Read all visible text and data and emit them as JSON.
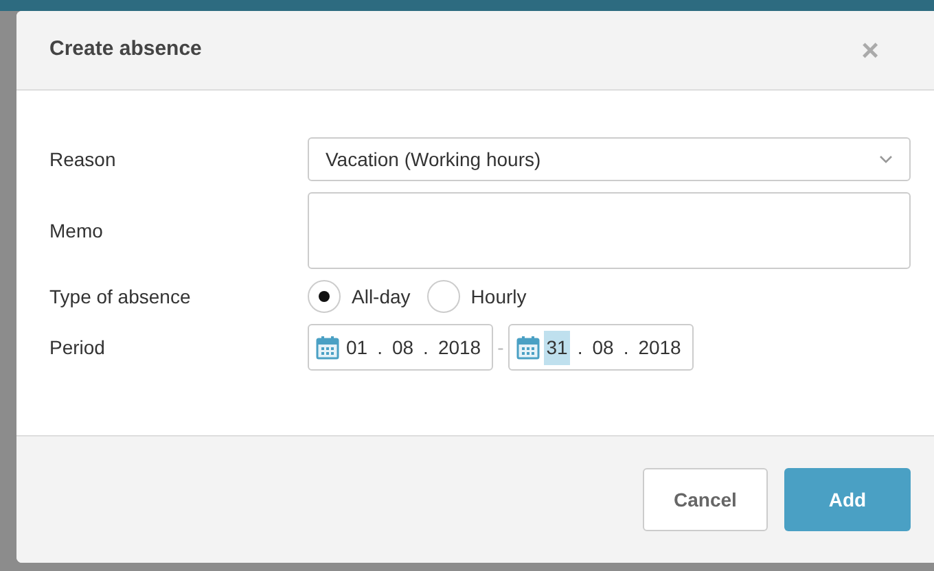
{
  "dialog": {
    "title": "Create absence",
    "close": "×"
  },
  "fields": [
    {
      "kind": "select",
      "label": "Reason",
      "value": "Vacation (Working hours)"
    },
    {
      "kind": "textarea",
      "label": "Memo"
    },
    {
      "kind": "radios",
      "label": "Type of absence",
      "options": [
        {
          "label": "All-day",
          "selected": true
        },
        {
          "label": "Hourly",
          "selected": false
        }
      ]
    },
    {
      "kind": "period",
      "label": "Period",
      "separator": "-",
      "dates": [
        {
          "parts": [
            {
              "text": "01",
              "selected": false
            },
            {
              "text": ".",
              "selected": false
            },
            {
              "text": "08",
              "selected": false
            },
            {
              "text": ".",
              "selected": false
            },
            {
              "text": "2018",
              "selected": false
            }
          ]
        },
        {
          "parts": [
            {
              "text": "31",
              "selected": true
            },
            {
              "text": ".",
              "selected": false
            },
            {
              "text": "08",
              "selected": false
            },
            {
              "text": ".",
              "selected": false
            },
            {
              "text": "2018",
              "selected": false
            }
          ]
        }
      ]
    }
  ],
  "buttons": [
    {
      "kind": "secondary",
      "label": "Cancel"
    },
    {
      "kind": "primary",
      "label": "Add"
    }
  ]
}
